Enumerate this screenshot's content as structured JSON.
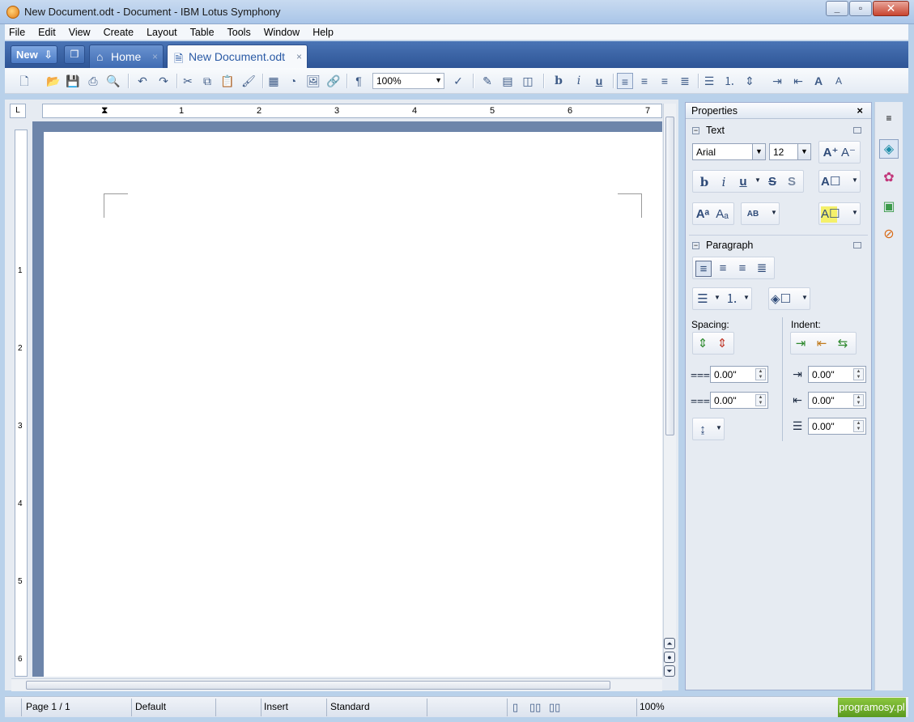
{
  "window": {
    "title": "New Document.odt - Document - IBM Lotus Symphony",
    "minimize": "_",
    "maximize": "▫",
    "close": "✕"
  },
  "menu": [
    "File",
    "Edit",
    "View",
    "Create",
    "Layout",
    "Table",
    "Tools",
    "Window",
    "Help"
  ],
  "tabs": {
    "new_label": "New",
    "home_label": "Home",
    "doc_label": "New Document.odt",
    "close_glyph": "×"
  },
  "toolbar": {
    "zoom_value": "100%",
    "bold": "b",
    "italic": "i",
    "underline": "u",
    "paragraph_mark": "¶",
    "grow_font": "A",
    "shrink_font": "A"
  },
  "ruler": {
    "h_numbers": [
      "1",
      "2",
      "3",
      "4",
      "5",
      "6",
      "7"
    ],
    "v_numbers": [
      "1",
      "2",
      "3",
      "4",
      "5",
      "6"
    ],
    "corner_glyph": "L"
  },
  "sidebar": {
    "title": "Properties",
    "close_glyph": "×",
    "text_section": {
      "title": "Text",
      "font_name": "Arial",
      "font_size": "12"
    },
    "paragraph_section": {
      "title": "Paragraph",
      "spacing_label": "Spacing:",
      "indent_label": "Indent:",
      "spacing_above": "0.00\"",
      "spacing_below": "0.00\"",
      "indent_before": "0.00\"",
      "indent_after": "0.00\"",
      "indent_first": "0.00\""
    }
  },
  "status": {
    "page": "Page 1 / 1",
    "style": "Default",
    "mode": "Insert",
    "selection": "Standard",
    "zoom": "100%"
  },
  "brand": "programosy.pl"
}
